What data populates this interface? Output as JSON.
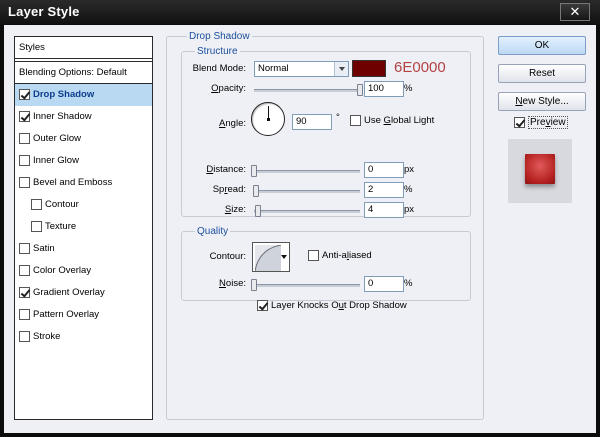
{
  "window": {
    "title": "Layer Style",
    "close_glyph": "✕"
  },
  "styles_panel": {
    "header": "Styles",
    "blending": "Blending Options: Default",
    "items": [
      {
        "label": "Drop Shadow",
        "checked": true,
        "selected": true,
        "indent": false
      },
      {
        "label": "Inner Shadow",
        "checked": true,
        "selected": false,
        "indent": false
      },
      {
        "label": "Outer Glow",
        "checked": false,
        "selected": false,
        "indent": false
      },
      {
        "label": "Inner Glow",
        "checked": false,
        "selected": false,
        "indent": false
      },
      {
        "label": "Bevel and Emboss",
        "checked": false,
        "selected": false,
        "indent": false
      },
      {
        "label": "Contour",
        "checked": false,
        "selected": false,
        "indent": true
      },
      {
        "label": "Texture",
        "checked": false,
        "selected": false,
        "indent": true
      },
      {
        "label": "Satin",
        "checked": false,
        "selected": false,
        "indent": false
      },
      {
        "label": "Color Overlay",
        "checked": false,
        "selected": false,
        "indent": false
      },
      {
        "label": "Gradient Overlay",
        "checked": true,
        "selected": false,
        "indent": false
      },
      {
        "label": "Pattern Overlay",
        "checked": false,
        "selected": false,
        "indent": false
      },
      {
        "label": "Stroke",
        "checked": false,
        "selected": false,
        "indent": false
      }
    ]
  },
  "drop_shadow": {
    "title": "Drop Shadow",
    "structure": {
      "title": "Structure",
      "blend_mode_label": "Blend Mode:",
      "blend_mode_value": "Normal",
      "color": "#6E0000",
      "color_hex_text": "6E0000",
      "opacity_label": "Opacity:",
      "opacity_value": "100",
      "opacity_level": 100,
      "opacity_unit": "%",
      "angle_label": "Angle:",
      "angle_value": "90",
      "angle_unit": "°",
      "use_global_light_label": "Use Global Light",
      "use_global_light_checked": false,
      "distance_label": "Distance:",
      "distance_value": "0",
      "distance_level": 0,
      "distance_unit": "px",
      "spread_label": "Spread:",
      "spread_value": "2",
      "spread_level": 2,
      "spread_unit": "%",
      "size_label": "Size:",
      "size_value": "4",
      "size_level": 4,
      "size_unit": "px"
    },
    "quality": {
      "title": "Quality",
      "contour_label": "Contour:",
      "anti_aliased_label": "Anti-aliased",
      "anti_aliased_checked": false,
      "noise_label": "Noise:",
      "noise_value": "0",
      "noise_level": 0,
      "noise_unit": "%"
    },
    "knockout_label": "Layer Knocks Out Drop Shadow",
    "knockout_checked": true
  },
  "buttons": {
    "ok": "OK",
    "reset": "Reset",
    "new_style": "New Style...",
    "preview_label": "Preview",
    "preview_checked": true
  }
}
